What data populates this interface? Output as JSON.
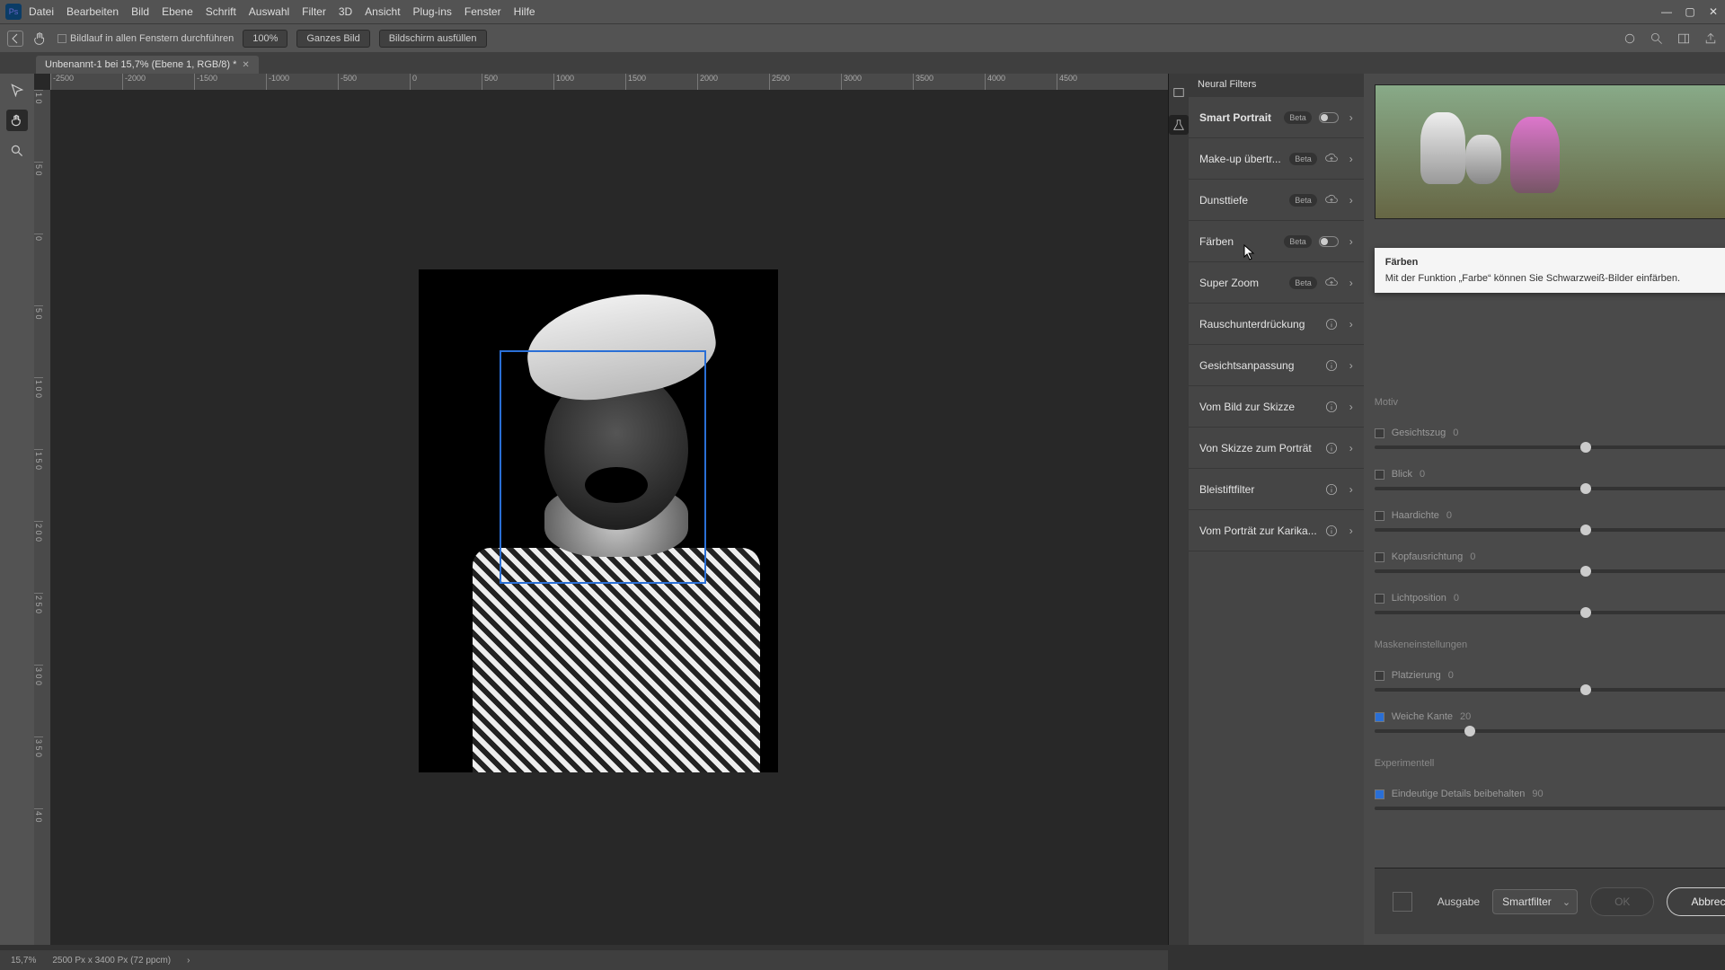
{
  "menu": [
    "Datei",
    "Bearbeiten",
    "Bild",
    "Ebene",
    "Schrift",
    "Auswahl",
    "Filter",
    "3D",
    "Ansicht",
    "Plug-ins",
    "Fenster",
    "Hilfe"
  ],
  "optbar": {
    "scroll_label": "Bildlauf in allen Fenstern durchführen",
    "zoom100": "100%",
    "fit": "Ganzes Bild",
    "fill": "Bildschirm ausfüllen"
  },
  "doctab": {
    "title": "Unbenannt-1 bei 15,7% (Ebene 1, RGB/8) *"
  },
  "ruler_h": [
    "-2500",
    "-2000",
    "-1500",
    "-1000",
    "-500",
    "0",
    "500",
    "1000",
    "1500",
    "2000",
    "2500",
    "3000",
    "3500",
    "4000",
    "4500"
  ],
  "ruler_v": [
    "1 0",
    "5 0",
    "0",
    "5 0",
    "1 0 0",
    "1 5 0",
    "2 0 0",
    "2 5 0",
    "3 0 0",
    "3 5 0",
    "4 0"
  ],
  "nf": {
    "header": "Neural Filters",
    "filters": [
      {
        "name": "Smart Portrait",
        "badge": "Beta",
        "ctrl": "toggle",
        "bold": true
      },
      {
        "name": "Make-up übertr...",
        "badge": "Beta",
        "ctrl": "cloud"
      },
      {
        "name": "Dunsttiefe",
        "badge": "Beta",
        "ctrl": "cloud"
      },
      {
        "name": "Färben",
        "badge": "Beta",
        "ctrl": "toggle"
      },
      {
        "name": "Super Zoom",
        "badge": "Beta",
        "ctrl": "cloud"
      },
      {
        "name": "Rauschunterdrückung",
        "ctrl": "info"
      },
      {
        "name": "Gesichtsanpassung",
        "ctrl": "info"
      },
      {
        "name": "Vom Bild zur Skizze",
        "ctrl": "info"
      },
      {
        "name": "Von Skizze zum Porträt",
        "ctrl": "info"
      },
      {
        "name": "Bleistiftfilter",
        "ctrl": "info"
      },
      {
        "name": "Vom Porträt zur Karika...",
        "ctrl": "info"
      }
    ]
  },
  "tooltip": {
    "title": "Färben",
    "body": "Mit der Funktion „Farbe“ können Sie Schwarzweiß-Bilder einfärben."
  },
  "settings": {
    "section_motiv": "Motiv",
    "sliders_motiv": [
      {
        "label": "Gesichtszug",
        "value": "0",
        "checked": false,
        "pos": 50
      },
      {
        "label": "Blick",
        "value": "0",
        "checked": false,
        "pos": 50
      },
      {
        "label": "Haardichte",
        "value": "0",
        "checked": false,
        "pos": 50
      },
      {
        "label": "Kopfausrichtung",
        "value": "0",
        "checked": false,
        "pos": 50
      },
      {
        "label": "Lichtposition",
        "value": "0",
        "checked": false,
        "pos": 50
      }
    ],
    "section_mask": "Maskeneinstellungen",
    "sliders_mask": [
      {
        "label": "Platzierung",
        "value": "0",
        "checked": false,
        "pos": 50
      },
      {
        "label": "Weiche Kante",
        "value": "20",
        "checked": true,
        "pos": 22
      }
    ],
    "section_exp": "Experimentell",
    "sliders_exp": [
      {
        "label": "Eindeutige Details beibehalten",
        "value": "90",
        "checked": true,
        "pos": 88
      }
    ]
  },
  "footer": {
    "output_label": "Ausgabe",
    "output_value": "Smartfilter",
    "ok": "OK",
    "cancel": "Abbrechen"
  },
  "status": {
    "zoom": "15,7%",
    "docinfo": "2500 Px x 3400 Px (72 ppcm)"
  }
}
